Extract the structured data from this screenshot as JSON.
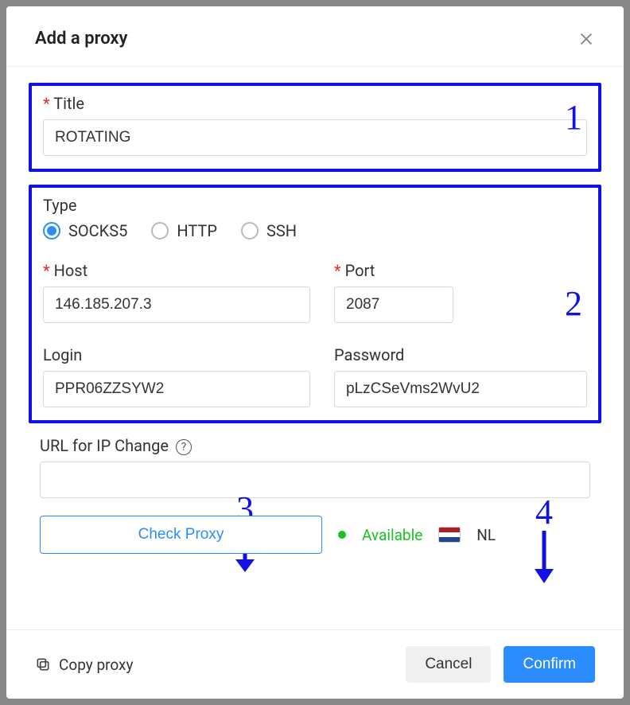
{
  "modal": {
    "title": "Add a proxy"
  },
  "annotations": {
    "n1": "1",
    "n2": "2",
    "n3": "3",
    "n4": "4"
  },
  "fields": {
    "title": {
      "label": "Title",
      "value": "ROTATING"
    },
    "type": {
      "label": "Type",
      "options": {
        "socks5": "SOCKS5",
        "http": "HTTP",
        "ssh": "SSH"
      },
      "selected": "socks5"
    },
    "host": {
      "label": "Host",
      "value": "146.185.207.3"
    },
    "port": {
      "label": "Port",
      "value": "2087"
    },
    "login": {
      "label": "Login",
      "value": "PPR06ZZSYW2"
    },
    "password": {
      "label": "Password",
      "value": "pLzCSeVms2WvU2"
    },
    "url_change": {
      "label": "URL for IP Change",
      "value": ""
    }
  },
  "status": {
    "check_label": "Check Proxy",
    "available": "Available",
    "country_code": "NL"
  },
  "footer": {
    "copy": "Copy proxy",
    "cancel": "Cancel",
    "confirm": "Confirm"
  }
}
